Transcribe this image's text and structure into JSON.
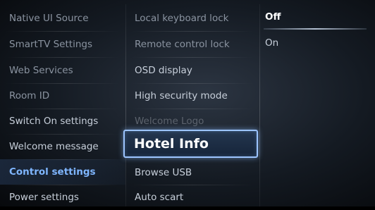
{
  "menu_col1": {
    "items": [
      {
        "label": "Native UI Source"
      },
      {
        "label": "SmartTV Settings"
      },
      {
        "label": "Web Services"
      },
      {
        "label": "Room ID"
      },
      {
        "label": "Switch On settings"
      },
      {
        "label": "Welcome message"
      },
      {
        "label": "Control settings"
      },
      {
        "label": "Power settings"
      }
    ]
  },
  "menu_col2": {
    "items": [
      {
        "label": "Local keyboard lock"
      },
      {
        "label": "Remote control lock"
      },
      {
        "label": "OSD display"
      },
      {
        "label": "High security mode"
      },
      {
        "label": "Welcome Logo"
      },
      {
        "label": "Hotel Info"
      },
      {
        "label": "Browse USB"
      },
      {
        "label": "Auto scart"
      }
    ]
  },
  "options": {
    "items": [
      {
        "label": "Off"
      },
      {
        "label": "On"
      }
    ]
  }
}
